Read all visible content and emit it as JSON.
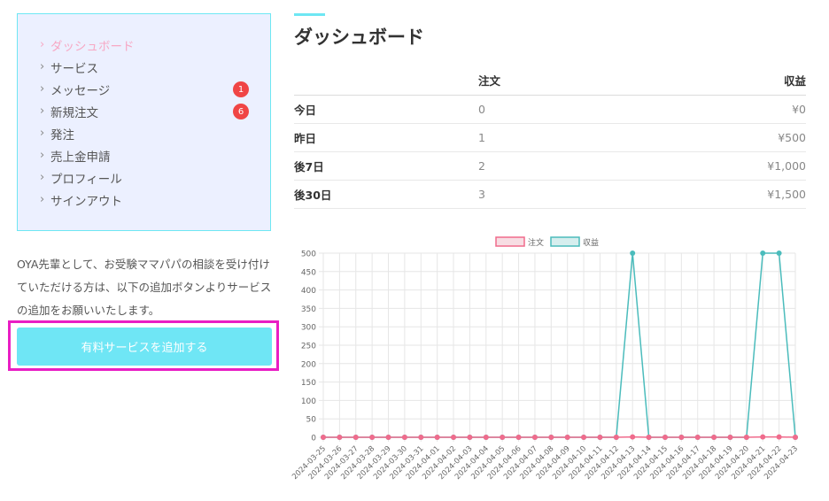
{
  "sidebar": {
    "items": [
      {
        "label": "ダッシュボード",
        "active": true,
        "badge": null
      },
      {
        "label": "サービス",
        "active": false,
        "badge": null
      },
      {
        "label": "メッセージ",
        "active": false,
        "badge": "1"
      },
      {
        "label": "新規注文",
        "active": false,
        "badge": "6"
      },
      {
        "label": "発注",
        "active": false,
        "badge": null
      },
      {
        "label": "売上金申請",
        "active": false,
        "badge": null
      },
      {
        "label": "プロフィール",
        "active": false,
        "badge": null
      },
      {
        "label": "サインアウト",
        "active": false,
        "badge": null
      }
    ]
  },
  "intro_text": "OYA先輩として、お受験ママパパの相談を受け付けていただける方は、以下の追加ボタンよりサービスの追加をお願いいたします。",
  "cta_label": "有料サービスを追加する",
  "page_title": "ダッシュボード",
  "stats": {
    "headers": {
      "period": "",
      "orders": "注文",
      "revenue": "収益"
    },
    "rows": [
      {
        "period": "今日",
        "orders": "0",
        "revenue": "¥0"
      },
      {
        "period": "昨日",
        "orders": "1",
        "revenue": "¥500"
      },
      {
        "period": "後7日",
        "orders": "2",
        "revenue": "¥1,000"
      },
      {
        "period": "後30日",
        "orders": "3",
        "revenue": "¥1,500"
      }
    ]
  },
  "colors": {
    "accent": "#6ee7f3",
    "active_menu": "#f7a8c4",
    "badge": "#f04545",
    "cta_background": "#6fe6f5",
    "highlight_outline": "#e91ec4",
    "series_orders": "#f06b8c",
    "series_revenue": "#4bbcbc"
  },
  "chart_data": {
    "type": "line",
    "legend_position": "top",
    "grid": true,
    "ylim": [
      0,
      500
    ],
    "yticks": [
      0,
      50,
      100,
      150,
      200,
      250,
      300,
      350,
      400,
      450,
      500
    ],
    "x": [
      "2024-03-25",
      "2024-03-26",
      "2024-03-27",
      "2024-03-28",
      "2024-03-29",
      "2024-03-30",
      "2024-03-31",
      "2024-04-01",
      "2024-04-02",
      "2024-04-03",
      "2024-04-04",
      "2024-04-05",
      "2024-04-06",
      "2024-04-07",
      "2024-04-08",
      "2024-04-09",
      "2024-04-10",
      "2024-04-11",
      "2024-04-12",
      "2024-04-13",
      "2024-04-14",
      "2024-04-15",
      "2024-04-16",
      "2024-04-17",
      "2024-04-18",
      "2024-04-19",
      "2024-04-20",
      "2024-04-21",
      "2024-04-22",
      "2024-04-23"
    ],
    "series": [
      {
        "name": "注文",
        "values": [
          0,
          0,
          0,
          0,
          0,
          0,
          0,
          0,
          0,
          0,
          0,
          0,
          0,
          0,
          0,
          0,
          0,
          0,
          0,
          1,
          0,
          0,
          0,
          0,
          0,
          0,
          0,
          1,
          1,
          0
        ]
      },
      {
        "name": "収益",
        "values": [
          0,
          0,
          0,
          0,
          0,
          0,
          0,
          0,
          0,
          0,
          0,
          0,
          0,
          0,
          0,
          0,
          0,
          0,
          0,
          500,
          0,
          0,
          0,
          0,
          0,
          0,
          0,
          500,
          500,
          0
        ]
      }
    ]
  }
}
